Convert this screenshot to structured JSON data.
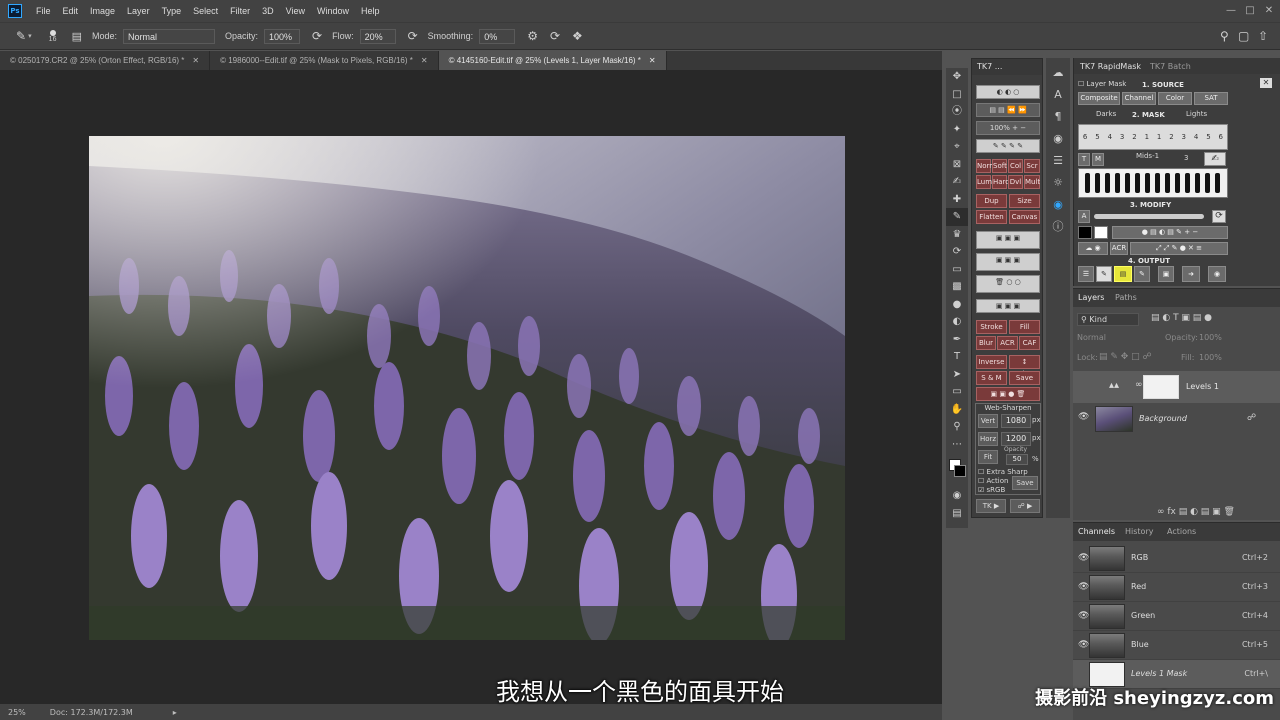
{
  "app": {
    "logo": "Ps"
  },
  "menu": [
    "File",
    "Edit",
    "Image",
    "Layer",
    "Type",
    "Select",
    "Filter",
    "3D",
    "View",
    "Window",
    "Help"
  ],
  "options": {
    "brush_size": "16",
    "mode_label": "Mode:",
    "mode_value": "Normal",
    "opacity_label": "Opacity:",
    "opacity_value": "100%",
    "flow_label": "Flow:",
    "flow_value": "20%",
    "smoothing_label": "Smoothing:",
    "smoothing_value": "0%"
  },
  "tabs": [
    {
      "label": "© 0250179.CR2 @ 25% (Orton Effect, RGB/16) *",
      "active": false
    },
    {
      "label": "© 1986000--Edit.tif @ 25% (Mask to Pixels, RGB/16) *",
      "active": false
    },
    {
      "label": "© 4145160-Edit.tif @ 25% (Levels 1, Layer Mask/16) *",
      "active": true
    }
  ],
  "status": {
    "zoom": "25%",
    "doc": "Doc: 172.3M/172.3M"
  },
  "tk7": {
    "title": "TK7 ...",
    "buttons": {
      "norm": "Norm",
      "soft": "Soft",
      "col": "Col",
      "scr": "Scr",
      "lum": "Lum",
      "hard": "Hard",
      "dvl": "Dvl",
      "mult": "Mult",
      "dup_img": "Dup Img",
      "size": "Size",
      "flatten": "Flatten",
      "canvas": "Canvas",
      "stroke": "Stroke",
      "fill": "Fill",
      "blur": "Blur",
      "acr": "ACR",
      "caf": "CAF",
      "inverse": "Inverse",
      "select": "↕ Select",
      "sm": "S & M",
      "save": "Save",
      "pct100": "100%"
    },
    "web_sharpen": {
      "title": "Web-Sharpen",
      "vert_label": "Vert",
      "vert_value": "1080",
      "horz_label": "Horz",
      "horz_value": "1200",
      "unit": "px",
      "fit": "Fit",
      "opacity_label": "Opacity",
      "opacity_value": "50",
      "percent": "%",
      "extra_sharp": "Extra Sharp",
      "action": "Action",
      "srgb": "sRGB",
      "save": "Save"
    },
    "bottom": {
      "tk": "TK ▶",
      "lock": "▶"
    }
  },
  "rapidmask": {
    "tab1": "TK7 RapidMask",
    "tab2": "TK7 Batch",
    "layer_mask": "Layer Mask",
    "source_title": "1. SOURCE",
    "source_buttons": [
      "Composite",
      "Channel",
      "Color",
      "SAT"
    ],
    "mask_title": "2. MASK",
    "darks": "Darks",
    "lights": "Lights",
    "darks_nums": [
      "6",
      "5",
      "4",
      "3",
      "2",
      "1"
    ],
    "lights_nums": [
      "1",
      "2",
      "3",
      "4",
      "5",
      "6"
    ],
    "mids_label": "Mids-1",
    "tm": [
      "T",
      "M"
    ],
    "mids_nums": [
      "2",
      "1",
      "1",
      "2",
      "3"
    ],
    "modify_title": "3. MODIFY",
    "modify_a": "A",
    "acr": "ACR",
    "output_title": "4. OUTPUT"
  },
  "layers": {
    "tab_layers": "Layers",
    "tab_paths": "Paths",
    "kind": "Kind",
    "blend": "Normal",
    "opacity_label": "Opacity:",
    "opacity_value": "100%",
    "lock_label": "Lock:",
    "fill_label": "Fill:",
    "fill_value": "100%",
    "items": [
      {
        "name": "Levels 1",
        "selected": true
      },
      {
        "name": "Background",
        "selected": false
      }
    ]
  },
  "channels": {
    "tab_channels": "Channels",
    "tab_history": "History",
    "tab_actions": "Actions",
    "rows": [
      {
        "name": "RGB",
        "key": "Ctrl+2"
      },
      {
        "name": "Red",
        "key": "Ctrl+3"
      },
      {
        "name": "Green",
        "key": "Ctrl+4"
      },
      {
        "name": "Blue",
        "key": "Ctrl+5"
      },
      {
        "name": "Levels 1 Mask",
        "key": "Ctrl+\\"
      }
    ]
  },
  "subtitle": "我想从一个黑色的面具开始",
  "watermark": "摄影前沿 sheyingzyz.com",
  "colors": {
    "tk_red": "#7a3a3a",
    "accent_blue": "#31a8ff",
    "highlight": "#e6e63a"
  }
}
